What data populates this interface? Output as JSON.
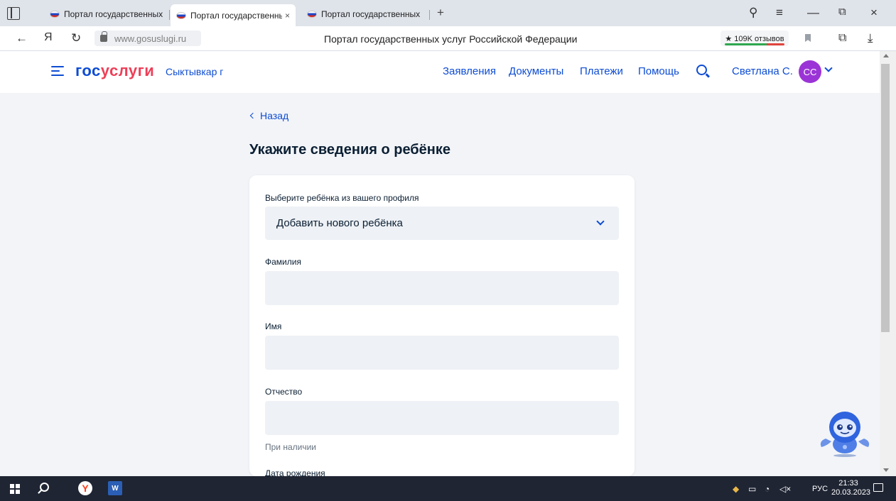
{
  "browser": {
    "tabs": [
      {
        "title": "Портал государственных у",
        "active": false
      },
      {
        "title": "Портал государственны",
        "active": true
      },
      {
        "title": "Портал государственных у",
        "active": false
      }
    ],
    "tab_close": "×",
    "new_tab": "+",
    "controls": {
      "minimize": "—",
      "restore": "⧉",
      "close": "×",
      "menu": "≡",
      "pin": "⚲"
    },
    "nav": {
      "back": "←",
      "yandex": "Я",
      "reload": "↻"
    },
    "url": "www.gosuslugi.ru",
    "page_title": "Портал государственных услуг Российской Федерации",
    "reviews_badge": "★ 109K отзывов",
    "download": "⤓",
    "ext": "⧉"
  },
  "header": {
    "logo_part1": "гос",
    "logo_part2": "услуги",
    "city": "Сыктывкар г",
    "nav_items": [
      "Заявления",
      "Документы",
      "Платежи",
      "Помощь"
    ],
    "user_name": "Светлана С.",
    "avatar_initials": "СС",
    "accent": "#0d4cd3",
    "logo_red": "#ee3f58",
    "avatar_color": "#9b34d6"
  },
  "content": {
    "back_label": "Назад",
    "heading": "Укажите сведения о ребёнке",
    "select_label": "Выберите ребёнка из вашего профиля",
    "select_value": "Добавить нового ребёнка",
    "fields": [
      {
        "label": "Фамилия",
        "value": ""
      },
      {
        "label": "Имя",
        "value": ""
      },
      {
        "label": "Отчество",
        "value": ""
      }
    ],
    "patronymic_hint": "При наличии",
    "next_field_label": "Дата рождения"
  },
  "taskbar": {
    "yandex_letter": "Y",
    "word_letter": "W",
    "language": "РУС",
    "time": "21:33",
    "date": "20.03.2023"
  }
}
